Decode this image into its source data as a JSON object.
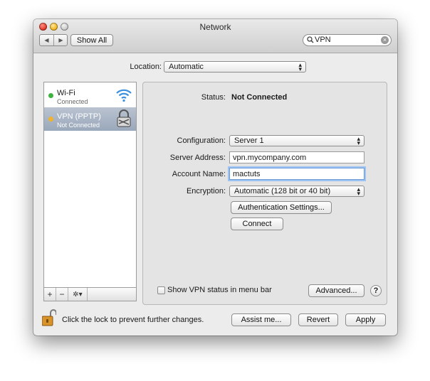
{
  "window": {
    "title": "Network"
  },
  "toolbar": {
    "back_glyph": "◀",
    "forward_glyph": "▶",
    "show_all_label": "Show All"
  },
  "search": {
    "value": "VPN",
    "icon": "magnifier-icon",
    "clear_glyph": "×"
  },
  "location": {
    "label": "Location:",
    "selected": "Automatic"
  },
  "sidebar": {
    "items": [
      {
        "name": "Wi-Fi",
        "status": "Connected",
        "status_color": "#3fb13f",
        "icon": "wifi-icon"
      },
      {
        "name": "VPN (PPTP)",
        "status": "Not Connected",
        "status_color": "#f0b32d",
        "icon": "vpn-lock-icon"
      }
    ],
    "add_glyph": "+",
    "remove_glyph": "−",
    "action_glyph": "✲▾"
  },
  "detail": {
    "status_label": "Status:",
    "status_value": "Not Connected",
    "configuration_label": "Configuration:",
    "configuration_value": "Server 1",
    "server_address_label": "Server Address:",
    "server_address_value": "vpn.mycompany.com",
    "account_name_label": "Account Name:",
    "account_name_value": "mactuts",
    "encryption_label": "Encryption:",
    "encryption_value": "Automatic (128 bit or 40 bit)",
    "auth_settings_label": "Authentication Settings...",
    "connect_label": "Connect"
  },
  "bottom": {
    "show_vpn_status_label": "Show VPN status in menu bar",
    "show_vpn_status_checked": false,
    "advanced_label": "Advanced...",
    "help_glyph": "?",
    "lock_text": "Click the lock to prevent further changes.",
    "assist_label": "Assist me...",
    "revert_label": "Revert",
    "apply_label": "Apply"
  },
  "colors": {
    "selection": "#9aa8bb",
    "focus_ring": "#9cc3f1"
  }
}
